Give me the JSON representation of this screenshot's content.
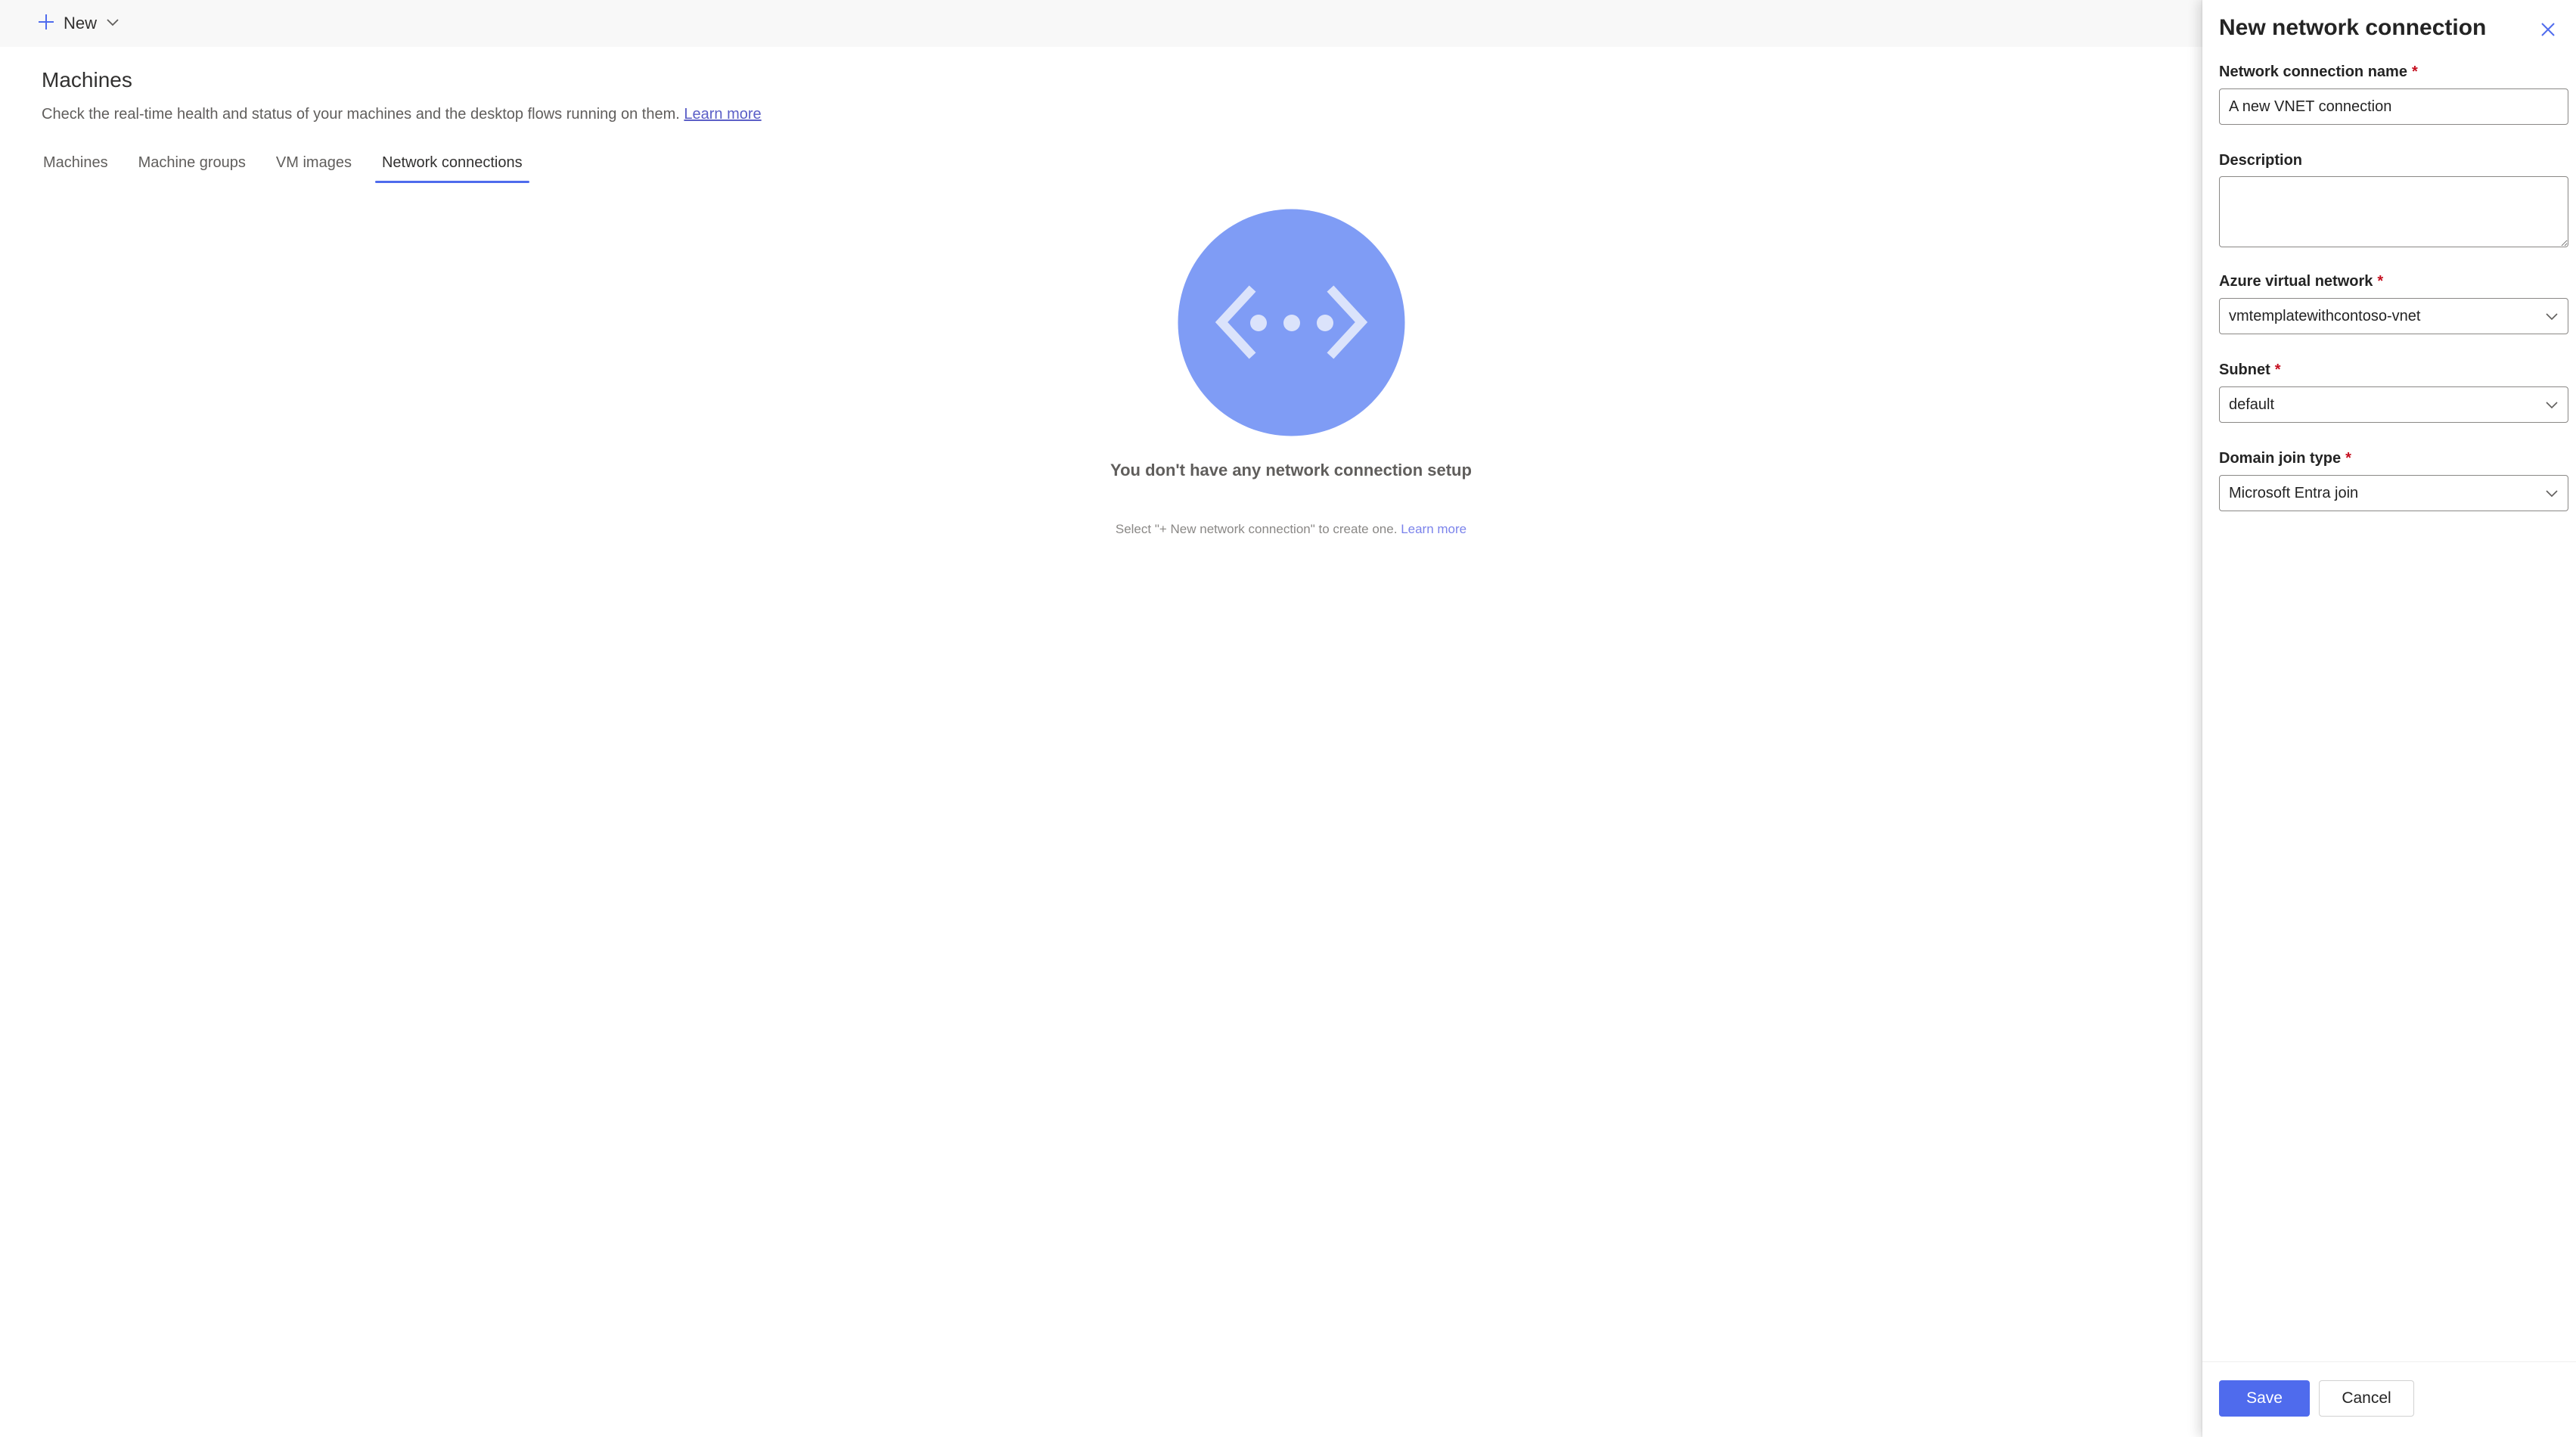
{
  "command_bar": {
    "new_label": "New",
    "icons": {
      "plus": "plus-icon",
      "dropdown": "chevron-down-icon"
    }
  },
  "page": {
    "title": "Machines",
    "subtitle": "Check the real-time health and status of your machines and the desktop flows running on them.",
    "learn_more": "Learn more"
  },
  "tabs": [
    {
      "label": "Machines",
      "active": false
    },
    {
      "label": "Machine groups",
      "active": false
    },
    {
      "label": "VM images",
      "active": false
    },
    {
      "label": "Network connections",
      "active": true
    }
  ],
  "empty_state": {
    "icon": "network-connection-icon",
    "title": "You don't have any network connection setup",
    "description": "Select \"+ New network connection\" to create one.",
    "learn_more": "Learn more"
  },
  "panel": {
    "title": "New network connection",
    "close_icon": "close-icon",
    "fields": {
      "name": {
        "label": "Network connection name",
        "required_mark": "*",
        "value": "A new VNET connection"
      },
      "description": {
        "label": "Description",
        "value": ""
      },
      "vnet": {
        "label": "Azure virtual network",
        "required_mark": "*",
        "value": "vmtemplatewithcontoso-vnet"
      },
      "subnet": {
        "label": "Subnet",
        "required_mark": "*",
        "value": "default"
      },
      "domain_join": {
        "label": "Domain join type",
        "required_mark": "*",
        "value": "Microsoft Entra join"
      }
    },
    "save_label": "Save",
    "cancel_label": "Cancel"
  },
  "colors": {
    "accent": "#4f6bed",
    "illustration": "#7f9cf5",
    "link": "#5b5fc7",
    "required": "#c50f1f"
  }
}
